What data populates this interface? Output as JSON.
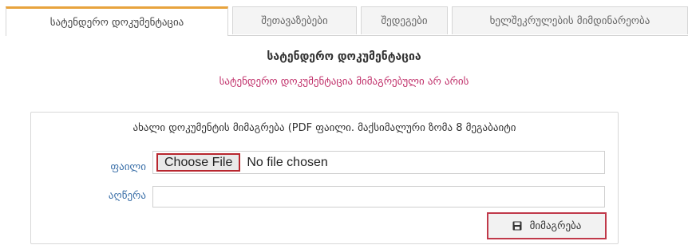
{
  "tabs": [
    {
      "label": "სატენდერო დოკუმენტაცია",
      "active": true
    },
    {
      "label": "შეთავაზებები",
      "active": false
    },
    {
      "label": "შედეგები",
      "active": false
    },
    {
      "label": "ხელშეკრულების მიმდინარეობა",
      "active": false
    }
  ],
  "main": {
    "title": "სატენდერო დოკუმენტაცია",
    "status_message": "სატენდერო დოკუმენტაცია მიმაგრებული არ არის"
  },
  "upload_form": {
    "title": "ახალი დოკუმენტის მიმაგრება (PDF ფაილი. მაქსიმალური ზომა 8 მეგაბაიტი",
    "file_label": "ფაილი",
    "choose_file_label": "Choose File",
    "no_file_text": "No file chosen",
    "description_label": "აღწერა",
    "description_value": "",
    "submit_label": "მიმაგრება",
    "submit_icon": "save-icon"
  },
  "colors": {
    "accent_tab": "#e8a33d",
    "status_text": "#c0306a",
    "label_text": "#3a6fa8",
    "highlight_border": "#b8262e"
  }
}
